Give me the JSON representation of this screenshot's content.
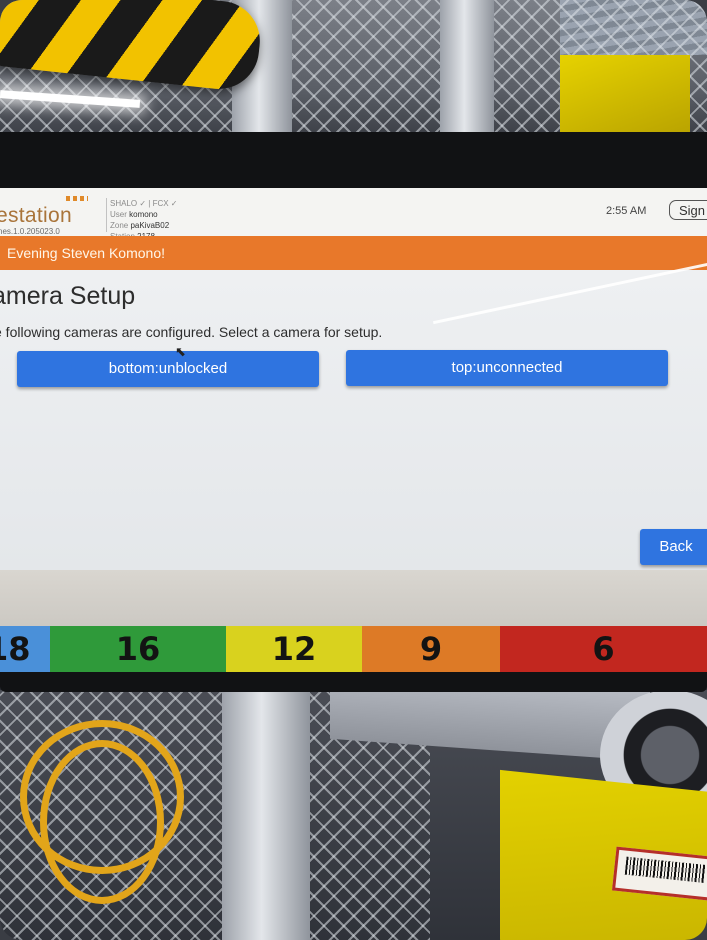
{
  "header": {
    "brand": "estation",
    "version": "nes.1.0.205023.0",
    "status_line": "SHALO ✓ | FCX ✓",
    "user_label": "User",
    "user_value": "komono",
    "zone_label": "Zone",
    "zone_value": "paKivaB02",
    "station_label": "Station",
    "station_value": "2178",
    "time": "2:55 AM",
    "signout_label": "Sign"
  },
  "greeting": "Evening Steven Komono!",
  "main": {
    "title": "amera Setup",
    "instruction": "e following cameras are configured. Select a camera for setup.",
    "cameras": [
      {
        "label": "bottom:unblocked"
      },
      {
        "label": "top:unconnected"
      }
    ],
    "back_label": "Back"
  },
  "strip": [
    {
      "label": "18",
      "color": "#4a90d9"
    },
    {
      "label": "16",
      "color": "#2f9a3a"
    },
    {
      "label": "12",
      "color": "#d9d21e"
    },
    {
      "label": "9",
      "color": "#dd7a26"
    },
    {
      "label": "6",
      "color": "#c2271f"
    }
  ],
  "colors": {
    "accent": "#2f74e0",
    "banner": "#e8782a"
  }
}
